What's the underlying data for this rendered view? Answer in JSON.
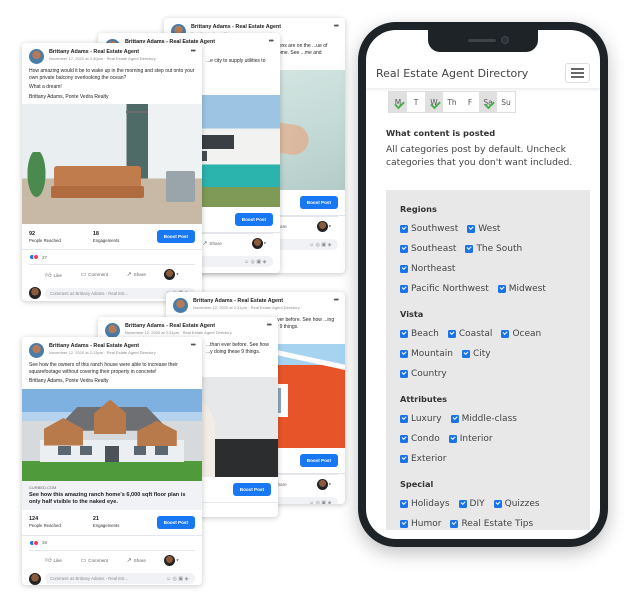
{
  "posts": {
    "author": "Brittany Adams - Real Estate Agent",
    "directory": "Real Estate Agent Directory",
    "boost_label": "Boost Post",
    "like_label": "Like",
    "comment_label": "Comment",
    "share_label": "Share",
    "comment_placeholder": "Comment as Brittany Adams - Real Est...",
    "people_reached_label": "People Reached",
    "engagements_label": "Engagements",
    "card_balcony": {
      "meta": "November 17, 2020 at 2:30pm · Real Estate Agent Directory",
      "text_1": "How amazing would it be to wake up in the morning and step out onto your own private balcony overlooking the ocean?",
      "text_2": "What a dream!",
      "text_3": "Brittany Adams, Ponte Vedra Realty",
      "people_reached": "92",
      "engagements": "18",
      "reaction_count": "27"
    },
    "card_utilities": {
      "text": "...e city to supply utilities to"
    },
    "card_renovations": {
      "text": "...ovations are on the ...ue of your home. See ...me and money."
    },
    "card_ever_before_back": {
      "meta": "November 12, 2020 at 2:31pm · Real Estate Agent Directory",
      "text": "...n ever before. See how ...ing these 9 things."
    },
    "card_ever_before_mid": {
      "meta": "November 12, 2020 at 2:31pm · Real Estate Agent Directory",
      "text": "...than ever before. See how ...y doing these 9 things."
    },
    "card_ranch": {
      "meta": "November 12, 2020 at 2:13pm · Real Estate Agent Directory",
      "text_1": "See how the owners of this ranch house were able to increase their squarefootage without covering their property in concrete!",
      "text_2": "Brittany Adams, Ponte Vedra Realty",
      "link_source": "CURBED.COM",
      "link_title": "See how this amazing ranch home's 6,000 sqft floor plan is only half visible to the naked eye.",
      "people_reached": "124",
      "engagements": "21",
      "reaction_count": "36"
    }
  },
  "phone": {
    "app_title": "Real Estate Agent Directory",
    "days": [
      {
        "label": "M",
        "checked": true
      },
      {
        "label": "T",
        "checked": false
      },
      {
        "label": "W",
        "checked": true
      },
      {
        "label": "Th",
        "checked": false
      },
      {
        "label": "F",
        "checked": false
      },
      {
        "label": "Sa",
        "checked": true
      },
      {
        "label": "Su",
        "checked": false
      }
    ],
    "content_heading": "What content is posted",
    "content_description": "All categories post by default. Uncheck categories that you don't want included.",
    "groups": {
      "regions": {
        "title": "Regions",
        "options": [
          "Southwest",
          "West",
          "Southeast",
          "The South",
          "Northeast",
          "Pacific Northwest",
          "Midwest"
        ]
      },
      "vista": {
        "title": "Vista",
        "options": [
          "Beach",
          "Coastal",
          "Ocean",
          "Mountain",
          "City",
          "Country"
        ]
      },
      "attributes": {
        "title": "Attributes",
        "options": [
          "Luxury",
          "Middle-class",
          "Condo",
          "Interior",
          "Exterior"
        ]
      },
      "special": {
        "title": "Special",
        "options": [
          "Holidays",
          "DIY",
          "Quizzes",
          "Humor",
          "Real Estate Tips"
        ]
      }
    }
  }
}
